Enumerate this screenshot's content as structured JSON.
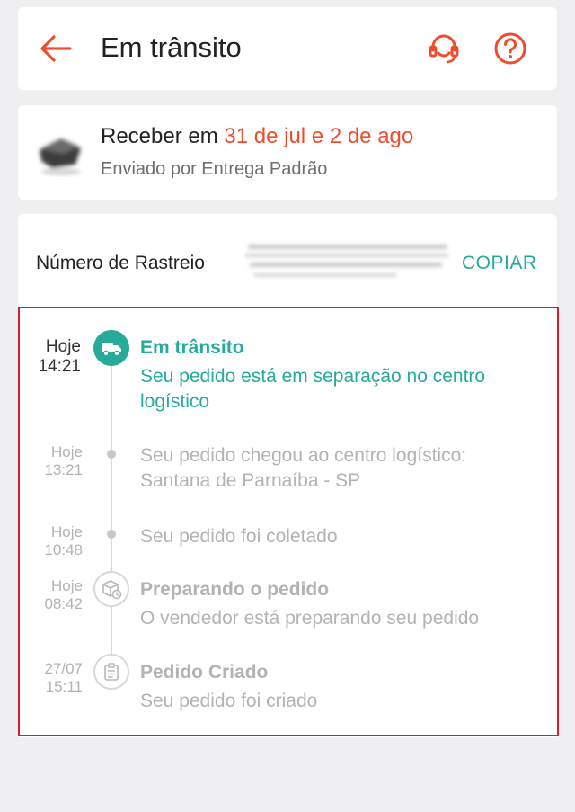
{
  "colors": {
    "accent": "#ee4d2d",
    "teal": "#26aa99",
    "muted": "#b3b3b3",
    "highlight_border": "#d0202a"
  },
  "header": {
    "title": "Em trânsito",
    "icons": {
      "back": "arrow-left-icon",
      "support": "headset-icon",
      "help": "question-circle-icon"
    }
  },
  "delivery": {
    "prefix": "Receber em ",
    "dates": "31 de jul e 2 de ago",
    "shipping": "Enviado por Entrega Padrão"
  },
  "tracking": {
    "label": "Número de Rastreio",
    "copy_label": "COPIAR"
  },
  "events": [
    {
      "day": "Hoje",
      "time": "14:21",
      "title": "Em trânsito",
      "desc": [
        "Seu pedido está em separação no centro",
        "logístico"
      ],
      "status": "active",
      "icon": "truck-icon"
    },
    {
      "day": "Hoje",
      "time": "13:21",
      "title": "",
      "desc": [
        "Seu pedido chegou ao centro logístico:",
        "Santana de Parnaíba - SP"
      ],
      "status": "muted",
      "icon": "dot-icon"
    },
    {
      "day": "Hoje",
      "time": "10:48",
      "title": "",
      "desc": [
        "Seu pedido foi coletado"
      ],
      "status": "muted",
      "icon": "dot-icon"
    },
    {
      "day": "Hoje",
      "time": "08:42",
      "title": "Preparando o pedido",
      "desc": [
        "O vendedor está preparando seu pedido"
      ],
      "status": "muted",
      "icon": "package-clock-icon"
    },
    {
      "day": "27/07",
      "time": "15:11",
      "title": "Pedido Criado",
      "desc": [
        "Seu pedido foi criado"
      ],
      "status": "muted",
      "icon": "clipboard-icon"
    }
  ]
}
